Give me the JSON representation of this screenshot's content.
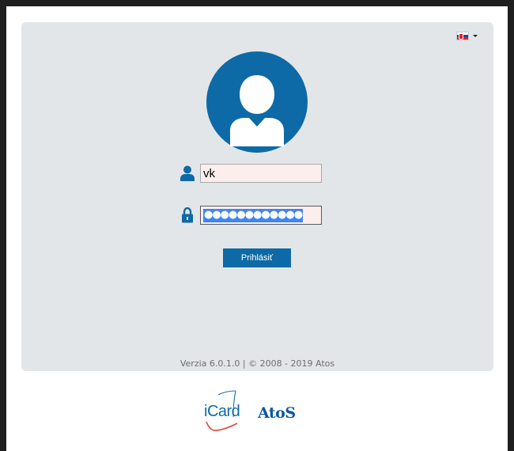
{
  "language": {
    "current": "SK",
    "flag_icon": "slovakia-flag-icon",
    "dropdown_icon": "caret-down-icon"
  },
  "login": {
    "avatar_icon": "user-avatar-icon",
    "username": {
      "icon": "user-icon",
      "value": "vk"
    },
    "password": {
      "icon": "lock-icon",
      "masked_value": "●●●●●●●●●●●●"
    },
    "submit_label": "Prihlásiť"
  },
  "footer": {
    "version_text": "Verzia 6.0.1.0 | © 2008 - 2019 Atos"
  },
  "logos": {
    "icard": "iCard",
    "atos": "AtoS"
  },
  "colors": {
    "accent": "#0d6aa6",
    "panel": "#e3e6e8",
    "field_bg": "#fdeeee",
    "selection": "#3d86f5",
    "icard_swoosh": "#e0453c"
  }
}
